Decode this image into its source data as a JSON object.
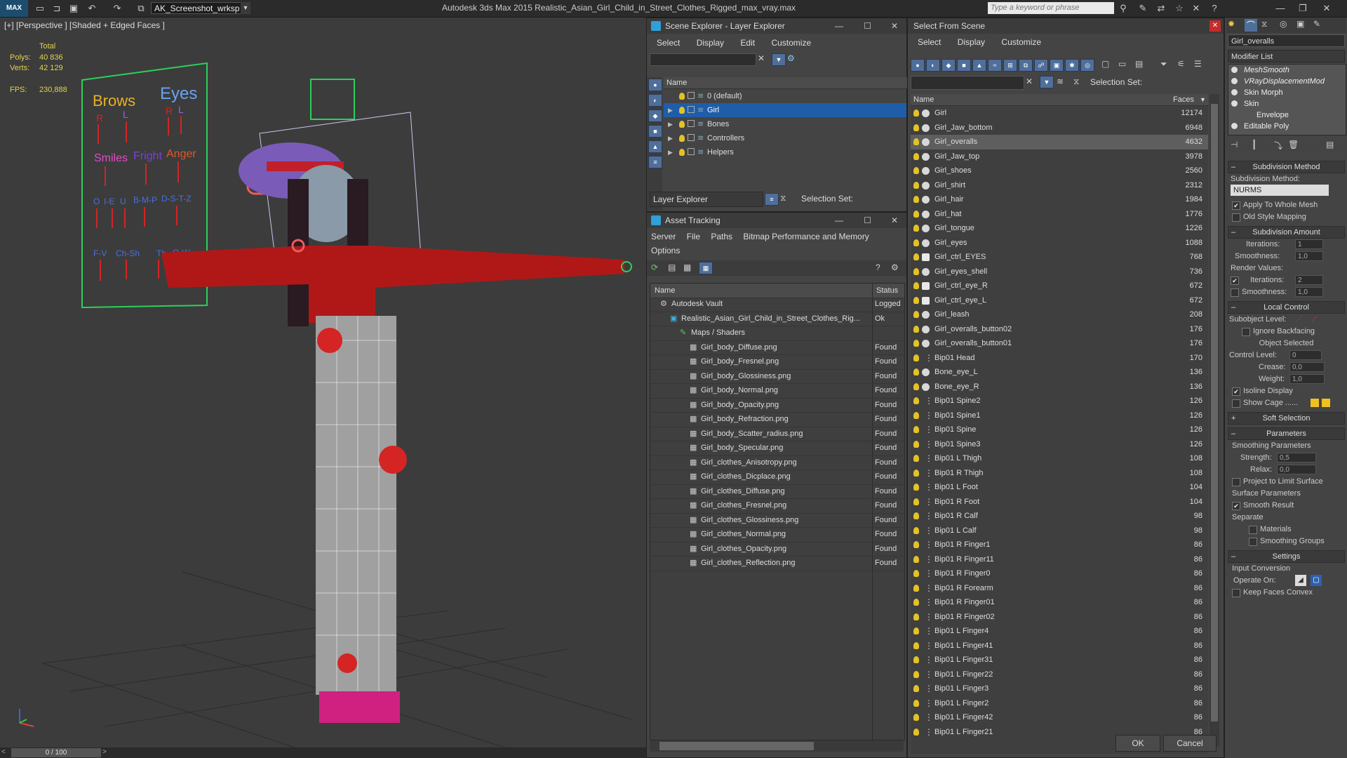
{
  "app": {
    "logo": "MAX",
    "workspace": "AK_Screenshot_wrksp",
    "title": "Autodesk 3ds Max  2015     Realistic_Asian_Girl_Child_in_Street_Clothes_Rigged_max_vray.max",
    "search_placeholder": "Type a keyword or phrase"
  },
  "viewport": {
    "label": "[+] [Perspective ] [Shaded + Edged Faces ]",
    "stats": {
      "total_label": "Total",
      "polys_label": "Polys:",
      "polys": "40 836",
      "verts_label": "Verts:",
      "verts": "42 129",
      "fps_label": "FPS:",
      "fps": "230,888"
    },
    "rig_board": {
      "brows": "Brows",
      "eyes": "Eyes",
      "r1": "R",
      "l1": "L",
      "r2": "R",
      "l2": "L",
      "smiles": "Smiles",
      "fright": "Fright",
      "anger": "Anger",
      "phon1": "O",
      "phon2": "I-E",
      "phon3": "U",
      "phon4": "B-M-P",
      "phon5": "D-S-T-Z",
      "phon6": "F-V",
      "phon7": "Ch-Sh",
      "phon8": "Th",
      "phon9": "Q-W"
    },
    "timeline": "0 / 100"
  },
  "scene_explorer": {
    "title": "Scene Explorer - Layer Explorer",
    "menu": [
      "Select",
      "Display",
      "Edit",
      "Customize"
    ],
    "col_name": "Name",
    "layers": [
      {
        "name": "0 (default)",
        "expandable": false,
        "selected": false
      },
      {
        "name": "Girl",
        "expandable": true,
        "selected": true
      },
      {
        "name": "Bones",
        "expandable": true,
        "selected": false
      },
      {
        "name": "Controllers",
        "expandable": true,
        "selected": false
      },
      {
        "name": "Helpers",
        "expandable": true,
        "selected": false
      }
    ],
    "footer_dropdown": "Layer Explorer",
    "selection_set_label": "Selection Set:"
  },
  "asset_tracking": {
    "title": "Asset Tracking",
    "menu": [
      "Server",
      "File",
      "Paths",
      "Bitmap Performance and Memory",
      "Options"
    ],
    "col_name": "Name",
    "col_status": "Status",
    "rows": [
      {
        "name": "Autodesk Vault",
        "status": "Logged",
        "indent": 1,
        "kind": "vault"
      },
      {
        "name": "Realistic_Asian_Girl_Child_in_Street_Clothes_Rig...",
        "status": "Ok",
        "indent": 2,
        "kind": "max"
      },
      {
        "name": "Maps / Shaders",
        "status": "",
        "indent": 3,
        "kind": "folder"
      },
      {
        "name": "Girl_body_Diffuse.png",
        "status": "Found",
        "indent": 4,
        "kind": "file"
      },
      {
        "name": "Girl_body_Fresnel.png",
        "status": "Found",
        "indent": 4,
        "kind": "file"
      },
      {
        "name": "Girl_body_Glossiness.png",
        "status": "Found",
        "indent": 4,
        "kind": "file"
      },
      {
        "name": "Girl_body_Normal.png",
        "status": "Found",
        "indent": 4,
        "kind": "file"
      },
      {
        "name": "Girl_body_Opacity.png",
        "status": "Found",
        "indent": 4,
        "kind": "file"
      },
      {
        "name": "Girl_body_Refraction.png",
        "status": "Found",
        "indent": 4,
        "kind": "file"
      },
      {
        "name": "Girl_body_Scatter_radius.png",
        "status": "Found",
        "indent": 4,
        "kind": "file"
      },
      {
        "name": "Girl_body_Specular.png",
        "status": "Found",
        "indent": 4,
        "kind": "file"
      },
      {
        "name": "Girl_clothes_Anisotropy.png",
        "status": "Found",
        "indent": 4,
        "kind": "file"
      },
      {
        "name": "Girl_clothes_Dicplace.png",
        "status": "Found",
        "indent": 4,
        "kind": "file"
      },
      {
        "name": "Girl_clothes_Diffuse.png",
        "status": "Found",
        "indent": 4,
        "kind": "file"
      },
      {
        "name": "Girl_clothes_Fresnel.png",
        "status": "Found",
        "indent": 4,
        "kind": "file"
      },
      {
        "name": "Girl_clothes_Glossiness.png",
        "status": "Found",
        "indent": 4,
        "kind": "file"
      },
      {
        "name": "Girl_clothes_Normal.png",
        "status": "Found",
        "indent": 4,
        "kind": "file"
      },
      {
        "name": "Girl_clothes_Opacity.png",
        "status": "Found",
        "indent": 4,
        "kind": "file"
      },
      {
        "name": "Girl_clothes_Reflection.png",
        "status": "Found",
        "indent": 4,
        "kind": "file"
      }
    ]
  },
  "select_from_scene": {
    "title": "Select From Scene",
    "menu": [
      "Select",
      "Display",
      "Customize"
    ],
    "selection_set_label": "Selection Set:",
    "col_name": "Name",
    "col_faces": "Faces",
    "items": [
      {
        "name": "Girl",
        "faces": "12174",
        "kind": "mesh",
        "selected": false
      },
      {
        "name": "Girl_Jaw_bottom",
        "faces": "6948",
        "kind": "mesh",
        "selected": false
      },
      {
        "name": "Girl_overalls",
        "faces": "4632",
        "kind": "mesh",
        "selected": true
      },
      {
        "name": "Girl_Jaw_top",
        "faces": "3978",
        "kind": "mesh",
        "selected": false
      },
      {
        "name": "Girl_shoes",
        "faces": "2560",
        "kind": "mesh",
        "selected": false
      },
      {
        "name": "Girl_shirt",
        "faces": "2312",
        "kind": "mesh",
        "selected": false
      },
      {
        "name": "Girl_hair",
        "faces": "1984",
        "kind": "mesh",
        "selected": false
      },
      {
        "name": "Girl_hat",
        "faces": "1776",
        "kind": "mesh",
        "selected": false
      },
      {
        "name": "Girl_tongue",
        "faces": "1226",
        "kind": "mesh",
        "selected": false
      },
      {
        "name": "Girl_eyes",
        "faces": "1088",
        "kind": "mesh",
        "selected": false
      },
      {
        "name": "Girl_ctrl_EYES",
        "faces": "768",
        "kind": "shape",
        "selected": false
      },
      {
        "name": "Girl_eyes_shell",
        "faces": "736",
        "kind": "mesh",
        "selected": false
      },
      {
        "name": "Girl_ctrl_eye_R",
        "faces": "672",
        "kind": "shape",
        "selected": false
      },
      {
        "name": "Girl_ctrl_eye_L",
        "faces": "672",
        "kind": "shape",
        "selected": false
      },
      {
        "name": "Girl_leash",
        "faces": "208",
        "kind": "mesh",
        "selected": false
      },
      {
        "name": "Girl_overalls_button02",
        "faces": "176",
        "kind": "mesh",
        "selected": false
      },
      {
        "name": "Girl_overalls_button01",
        "faces": "176",
        "kind": "mesh",
        "selected": false
      },
      {
        "name": "Bip01 Head",
        "faces": "170",
        "kind": "bone",
        "selected": false
      },
      {
        "name": "Bone_eye_L",
        "faces": "136",
        "kind": "mesh",
        "selected": false
      },
      {
        "name": "Bone_eye_R",
        "faces": "136",
        "kind": "mesh",
        "selected": false
      },
      {
        "name": "Bip01 Spine2",
        "faces": "126",
        "kind": "bone",
        "selected": false
      },
      {
        "name": "Bip01 Spine1",
        "faces": "126",
        "kind": "bone",
        "selected": false
      },
      {
        "name": "Bip01 Spine",
        "faces": "126",
        "kind": "bone",
        "selected": false
      },
      {
        "name": "Bip01 Spine3",
        "faces": "126",
        "kind": "bone",
        "selected": false
      },
      {
        "name": "Bip01 L Thigh",
        "faces": "108",
        "kind": "bone",
        "selected": false
      },
      {
        "name": "Bip01 R Thigh",
        "faces": "108",
        "kind": "bone",
        "selected": false
      },
      {
        "name": "Bip01 L Foot",
        "faces": "104",
        "kind": "bone",
        "selected": false
      },
      {
        "name": "Bip01 R Foot",
        "faces": "104",
        "kind": "bone",
        "selected": false
      },
      {
        "name": "Bip01 R Calf",
        "faces": "98",
        "kind": "bone",
        "selected": false
      },
      {
        "name": "Bip01 L Calf",
        "faces": "98",
        "kind": "bone",
        "selected": false
      },
      {
        "name": "Bip01 R Finger1",
        "faces": "86",
        "kind": "bone",
        "selected": false
      },
      {
        "name": "Bip01 R Finger11",
        "faces": "86",
        "kind": "bone",
        "selected": false
      },
      {
        "name": "Bip01 R Finger0",
        "faces": "86",
        "kind": "bone",
        "selected": false
      },
      {
        "name": "Bip01 R Forearm",
        "faces": "86",
        "kind": "bone",
        "selected": false
      },
      {
        "name": "Bip01 R Finger01",
        "faces": "86",
        "kind": "bone",
        "selected": false
      },
      {
        "name": "Bip01 R Finger02",
        "faces": "86",
        "kind": "bone",
        "selected": false
      },
      {
        "name": "Bip01 L Finger4",
        "faces": "86",
        "kind": "bone",
        "selected": false
      },
      {
        "name": "Bip01 L Finger41",
        "faces": "86",
        "kind": "bone",
        "selected": false
      },
      {
        "name": "Bip01 L Finger31",
        "faces": "86",
        "kind": "bone",
        "selected": false
      },
      {
        "name": "Bip01 L Finger22",
        "faces": "86",
        "kind": "bone",
        "selected": false
      },
      {
        "name": "Bip01 L Finger3",
        "faces": "86",
        "kind": "bone",
        "selected": false
      },
      {
        "name": "Bip01 L Finger2",
        "faces": "86",
        "kind": "bone",
        "selected": false
      },
      {
        "name": "Bip01 L Finger42",
        "faces": "86",
        "kind": "bone",
        "selected": false
      },
      {
        "name": "Bip01 L Finger21",
        "faces": "86",
        "kind": "bone",
        "selected": false
      }
    ],
    "ok_label": "OK",
    "cancel_label": "Cancel"
  },
  "command_panel": {
    "object_name": "Girl_overalls",
    "modifier_list_label": "Modifier List",
    "stack": [
      {
        "name": "MeshSmooth",
        "italic": true
      },
      {
        "name": "VRayDisplacementMod",
        "italic": true
      },
      {
        "name": "Skin Morph",
        "italic": false
      },
      {
        "name": "Skin",
        "italic": false
      },
      {
        "name": "Envelope",
        "italic": false,
        "sub": true
      },
      {
        "name": "Editable Poly",
        "italic": false
      }
    ],
    "subdivision_method": {
      "header": "Subdivision Method",
      "label": "Subdivision Method:",
      "value": "NURMS",
      "apply_whole": "Apply To Whole Mesh",
      "old_style": "Old Style Mapping"
    },
    "subdivision_amount": {
      "header": "Subdivision Amount",
      "iterations_label": "Iterations:",
      "iterations": "1",
      "smoothness_label": "Smoothness:",
      "smoothness": "1,0",
      "render_values": "Render Values:",
      "r_iterations_label": "Iterations:",
      "r_iterations": "2",
      "r_smoothness_label": "Smoothness:",
      "r_smoothness": "1,0"
    },
    "local_control": {
      "header": "Local Control",
      "subobject_label": "Subobject Level:",
      "ignore_backfacing": "Ignore Backfacing",
      "object_selected": "Object Selected",
      "control_level_label": "Control Level:",
      "control_level": "0",
      "crease_label": "Crease:",
      "crease": "0,0",
      "weight_label": "Weight:",
      "weight": "1,0",
      "isoline": "Isoline Display",
      "show_cage": "Show Cage ......"
    },
    "soft_selection": {
      "header": "Soft Selection"
    },
    "parameters": {
      "header": "Parameters",
      "smoothing_params": "Smoothing Parameters",
      "strength_label": "Strength:",
      "strength": "0,5",
      "relax_label": "Relax:",
      "relax": "0,0",
      "project": "Project to Limit Surface",
      "surface_params": "Surface Parameters",
      "smooth_result": "Smooth Result",
      "separate": "Separate",
      "materials": "Materials",
      "smoothing_groups": "Smoothing Groups"
    },
    "settings": {
      "header": "Settings",
      "input_conversion": "Input Conversion",
      "operate_on": "Operate On:",
      "keep_faces": "Keep Faces Convex"
    }
  }
}
